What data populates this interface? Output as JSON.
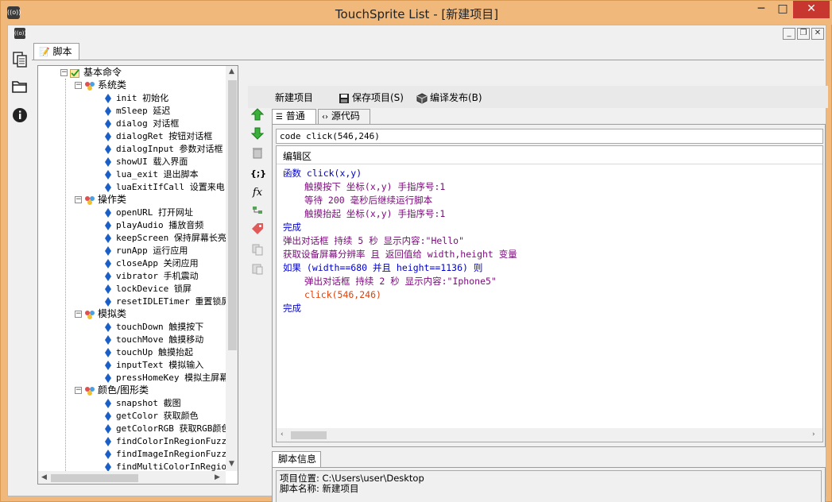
{
  "window": {
    "title": "TouchSprite List - [新建项目]",
    "logo_text": "((o))",
    "min_glyph": "─",
    "max_glyph": "□",
    "close_glyph": "✕"
  },
  "mdi": {
    "min": "_",
    "restore": "❐",
    "close": "✕"
  },
  "side_icons": [
    "documents-icon",
    "folder-icon",
    "info-icon"
  ],
  "panel_tab": "脚本",
  "tree": {
    "root": "基本命令",
    "categories": [
      {
        "label": "系统类",
        "items": [
          "init 初始化",
          "mSleep 延迟",
          "dialog 对话框",
          "dialogRet 按钮对话框",
          "dialogInput 参数对话框",
          "showUI 载入界面",
          "lua_exit 退出脚本",
          "luaExitIfCall 设置来电"
        ]
      },
      {
        "label": "操作类",
        "items": [
          "openURL 打开网址",
          "playAudio 播放音频",
          "keepScreen 保持屏幕长亮",
          "runApp 运行应用",
          "closeApp 关闭应用",
          "vibrator 手机震动",
          "lockDevice 锁屏",
          "resetIDLETimer 重置锁屏"
        ]
      },
      {
        "label": "模拟类",
        "items": [
          "touchDown 触摸按下",
          "touchMove 触摸移动",
          "touchUp 触摸抬起",
          "inputText 模拟输入",
          "pressHomeKey 模拟主屏幕"
        ]
      },
      {
        "label": "颜色/图形类",
        "items": [
          "snapshot 截图",
          "getColor 获取颜色",
          "getColorRGB 获取RGB颜色",
          "findColorInRegionFuzzy",
          "findImageInRegionFuzzy",
          "findMultiColorInRegion"
        ]
      }
    ]
  },
  "toolbar": {
    "new_project": "新建项目",
    "save_project": "保存项目(S)",
    "compile_publish": "编译发布(B)"
  },
  "editor_tabs": {
    "normal": "普通",
    "source": "源代码"
  },
  "code_line": "code click(546,246)",
  "edit_area": {
    "title": "编辑区",
    "lines": [
      "函数 click(x,y)",
      "触摸按下 坐标(x,y) 手指序号:1",
      "等待 200 毫秒后继续运行脚本",
      "触摸抬起 坐标(x,y) 手指序号:1",
      "完成",
      "弹出对话框 持续 5 秒 显示内容:\"Hello\"",
      "获取设备屏幕分辨率 且 返回值给 width,height 变量",
      "如果 (width==680 并且 height==1136) 则",
      "弹出对话框 持续 2 秒 显示内容:\"Iphone5\"",
      "click(546,246)",
      "完成"
    ]
  },
  "info": {
    "tab": "脚本信息",
    "location_line": "项目位置: C:\\Users\\user\\Desktop",
    "name_line": "脚本名称: 新建项目"
  },
  "colors": {
    "window_frame": "#f0b87a",
    "keyword": "#0000cc",
    "inner": "#7a0a7a",
    "call": "#e0400a"
  }
}
